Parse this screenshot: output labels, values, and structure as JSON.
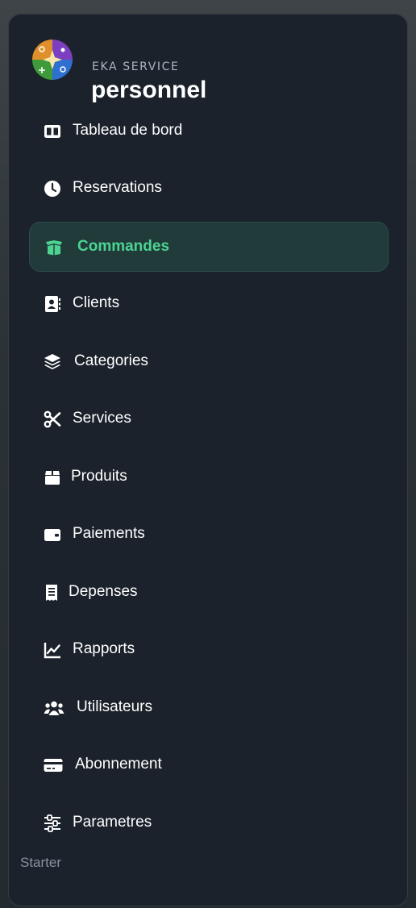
{
  "brand": {
    "subtitle": "EKA SERVICE",
    "title": "personnel"
  },
  "nav": {
    "items": [
      {
        "label": "Tableau de bord",
        "icon": "dashboard-columns-icon",
        "active": false
      },
      {
        "label": "Reservations",
        "icon": "clock-icon",
        "active": false
      },
      {
        "label": "Commandes",
        "icon": "open-box-icon",
        "active": true
      },
      {
        "label": "Clients",
        "icon": "contact-book-icon",
        "active": false
      },
      {
        "label": "Categories",
        "icon": "layers-icon",
        "active": false
      },
      {
        "label": "Services",
        "icon": "scissors-icon",
        "active": false
      },
      {
        "label": "Produits",
        "icon": "gift-box-icon",
        "active": false
      },
      {
        "label": "Paiements",
        "icon": "wallet-icon",
        "active": false
      },
      {
        "label": "Depenses",
        "icon": "receipt-icon",
        "active": false
      },
      {
        "label": "Rapports",
        "icon": "line-chart-icon",
        "active": false
      },
      {
        "label": "Utilisateurs",
        "icon": "users-icon",
        "active": false
      },
      {
        "label": "Abonnement",
        "icon": "credit-card-icon",
        "active": false
      },
      {
        "label": "Parametres",
        "icon": "sliders-icon",
        "active": false
      }
    ]
  },
  "plan_label": "Starter",
  "colors": {
    "active_accent": "#4cd392",
    "active_background": "#203b3a",
    "panel_background": "#1b222b",
    "text": "#ffffff",
    "muted_text": "#8793a0"
  }
}
